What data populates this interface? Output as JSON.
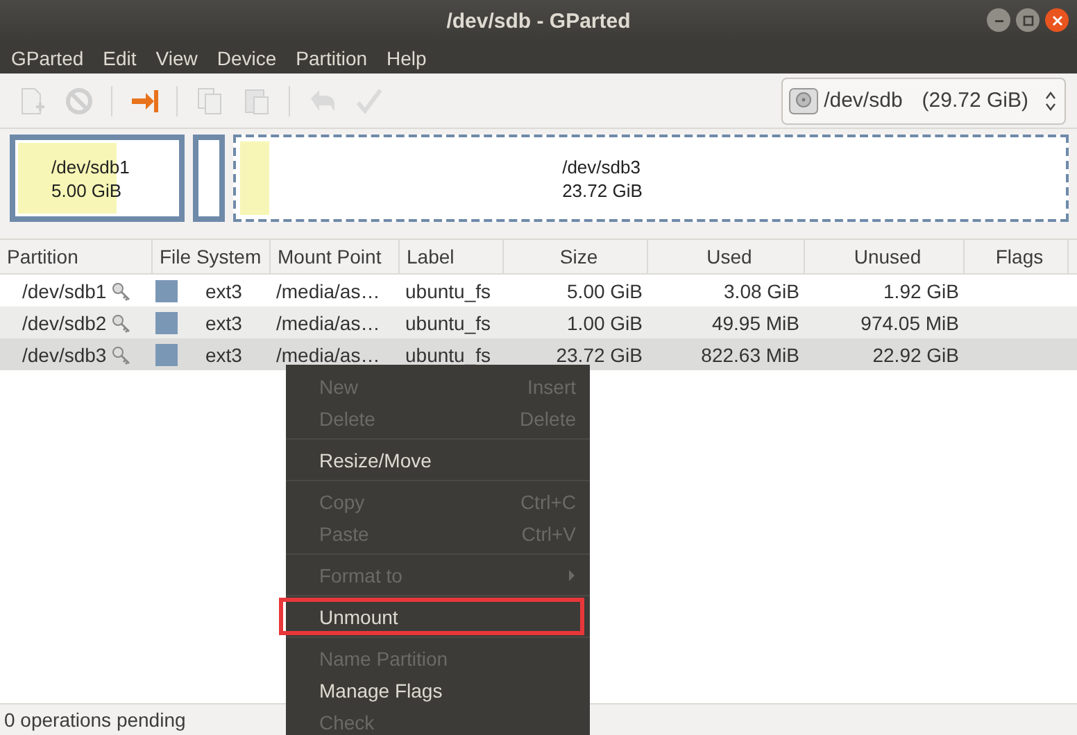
{
  "window": {
    "title": "/dev/sdb - GParted"
  },
  "menubar": [
    "GParted",
    "Edit",
    "View",
    "Device",
    "Partition",
    "Help"
  ],
  "toolbar": [
    {
      "kind": "new",
      "disabled": true
    },
    {
      "kind": "delete",
      "disabled": true
    },
    {
      "kind": "sep"
    },
    {
      "kind": "resize",
      "disabled": false
    },
    {
      "kind": "sep"
    },
    {
      "kind": "copy",
      "disabled": true
    },
    {
      "kind": "paste",
      "disabled": true
    },
    {
      "kind": "sep"
    },
    {
      "kind": "undo",
      "disabled": true
    },
    {
      "kind": "apply",
      "disabled": true
    }
  ],
  "device_selector": {
    "device": "/dev/sdb",
    "size": "(29.72 GiB)"
  },
  "disk_map": [
    {
      "name": "/dev/sdb1",
      "size": "5.00 GiB",
      "level": 0.62,
      "selected": false,
      "kind": "wide"
    },
    {
      "kind": "narrow",
      "selected": false
    },
    {
      "name": "/dev/sdb3",
      "size": "23.72 GiB",
      "level": 0.035,
      "selected": true,
      "kind": "fill"
    }
  ],
  "table": {
    "columns": [
      "Partition",
      "File System",
      "Mount Point",
      "Label",
      "Size",
      "Used",
      "Unused",
      "Flags"
    ],
    "rows": [
      {
        "partition": "/dev/sdb1",
        "color": "#7b97b6",
        "file_system": "ext3",
        "mount_point": "/media/as…",
        "label": "ubuntu_fs",
        "size": "5.00 GiB",
        "used": "3.08 GiB",
        "unused": "1.92 GiB",
        "selected": false
      },
      {
        "partition": "/dev/sdb2",
        "color": "#7b97b6",
        "file_system": "ext3",
        "mount_point": "/media/as…",
        "label": "ubuntu_fs",
        "size": "1.00 GiB",
        "used": "49.95 MiB",
        "unused": "974.05 MiB",
        "selected": false
      },
      {
        "partition": "/dev/sdb3",
        "color": "#7b97b6",
        "file_system": "ext3",
        "mount_point": "/media/as…",
        "label": "ubuntu_fs",
        "size": "23.72 GiB",
        "used": "822.63 MiB",
        "unused": "22.92 GiB",
        "selected": true
      }
    ]
  },
  "context_menu": [
    {
      "kind": "item",
      "label": "New",
      "shortcut": "Insert",
      "disabled": true,
      "highlighted": false
    },
    {
      "kind": "item",
      "label": "Delete",
      "shortcut": "Delete",
      "disabled": true,
      "highlighted": false
    },
    {
      "kind": "separator"
    },
    {
      "kind": "item",
      "label": "Resize/Move",
      "disabled": false,
      "highlighted": false
    },
    {
      "kind": "separator"
    },
    {
      "kind": "item",
      "label": "Copy",
      "shortcut": "Ctrl+C",
      "disabled": true,
      "highlighted": false
    },
    {
      "kind": "item",
      "label": "Paste",
      "shortcut": "Ctrl+V",
      "disabled": true,
      "highlighted": false
    },
    {
      "kind": "separator"
    },
    {
      "kind": "submenu",
      "label": "Format to",
      "disabled": true,
      "highlighted": false
    },
    {
      "kind": "separator"
    },
    {
      "kind": "item",
      "label": "Unmount",
      "disabled": false,
      "highlighted": true
    },
    {
      "kind": "separator"
    },
    {
      "kind": "item",
      "label": "Name Partition",
      "disabled": true,
      "highlighted": false
    },
    {
      "kind": "item",
      "label": "Manage Flags",
      "disabled": false,
      "highlighted": false
    },
    {
      "kind": "item",
      "label": "Check",
      "disabled": true,
      "highlighted": false
    }
  ],
  "status_bar": "0 operations pending"
}
